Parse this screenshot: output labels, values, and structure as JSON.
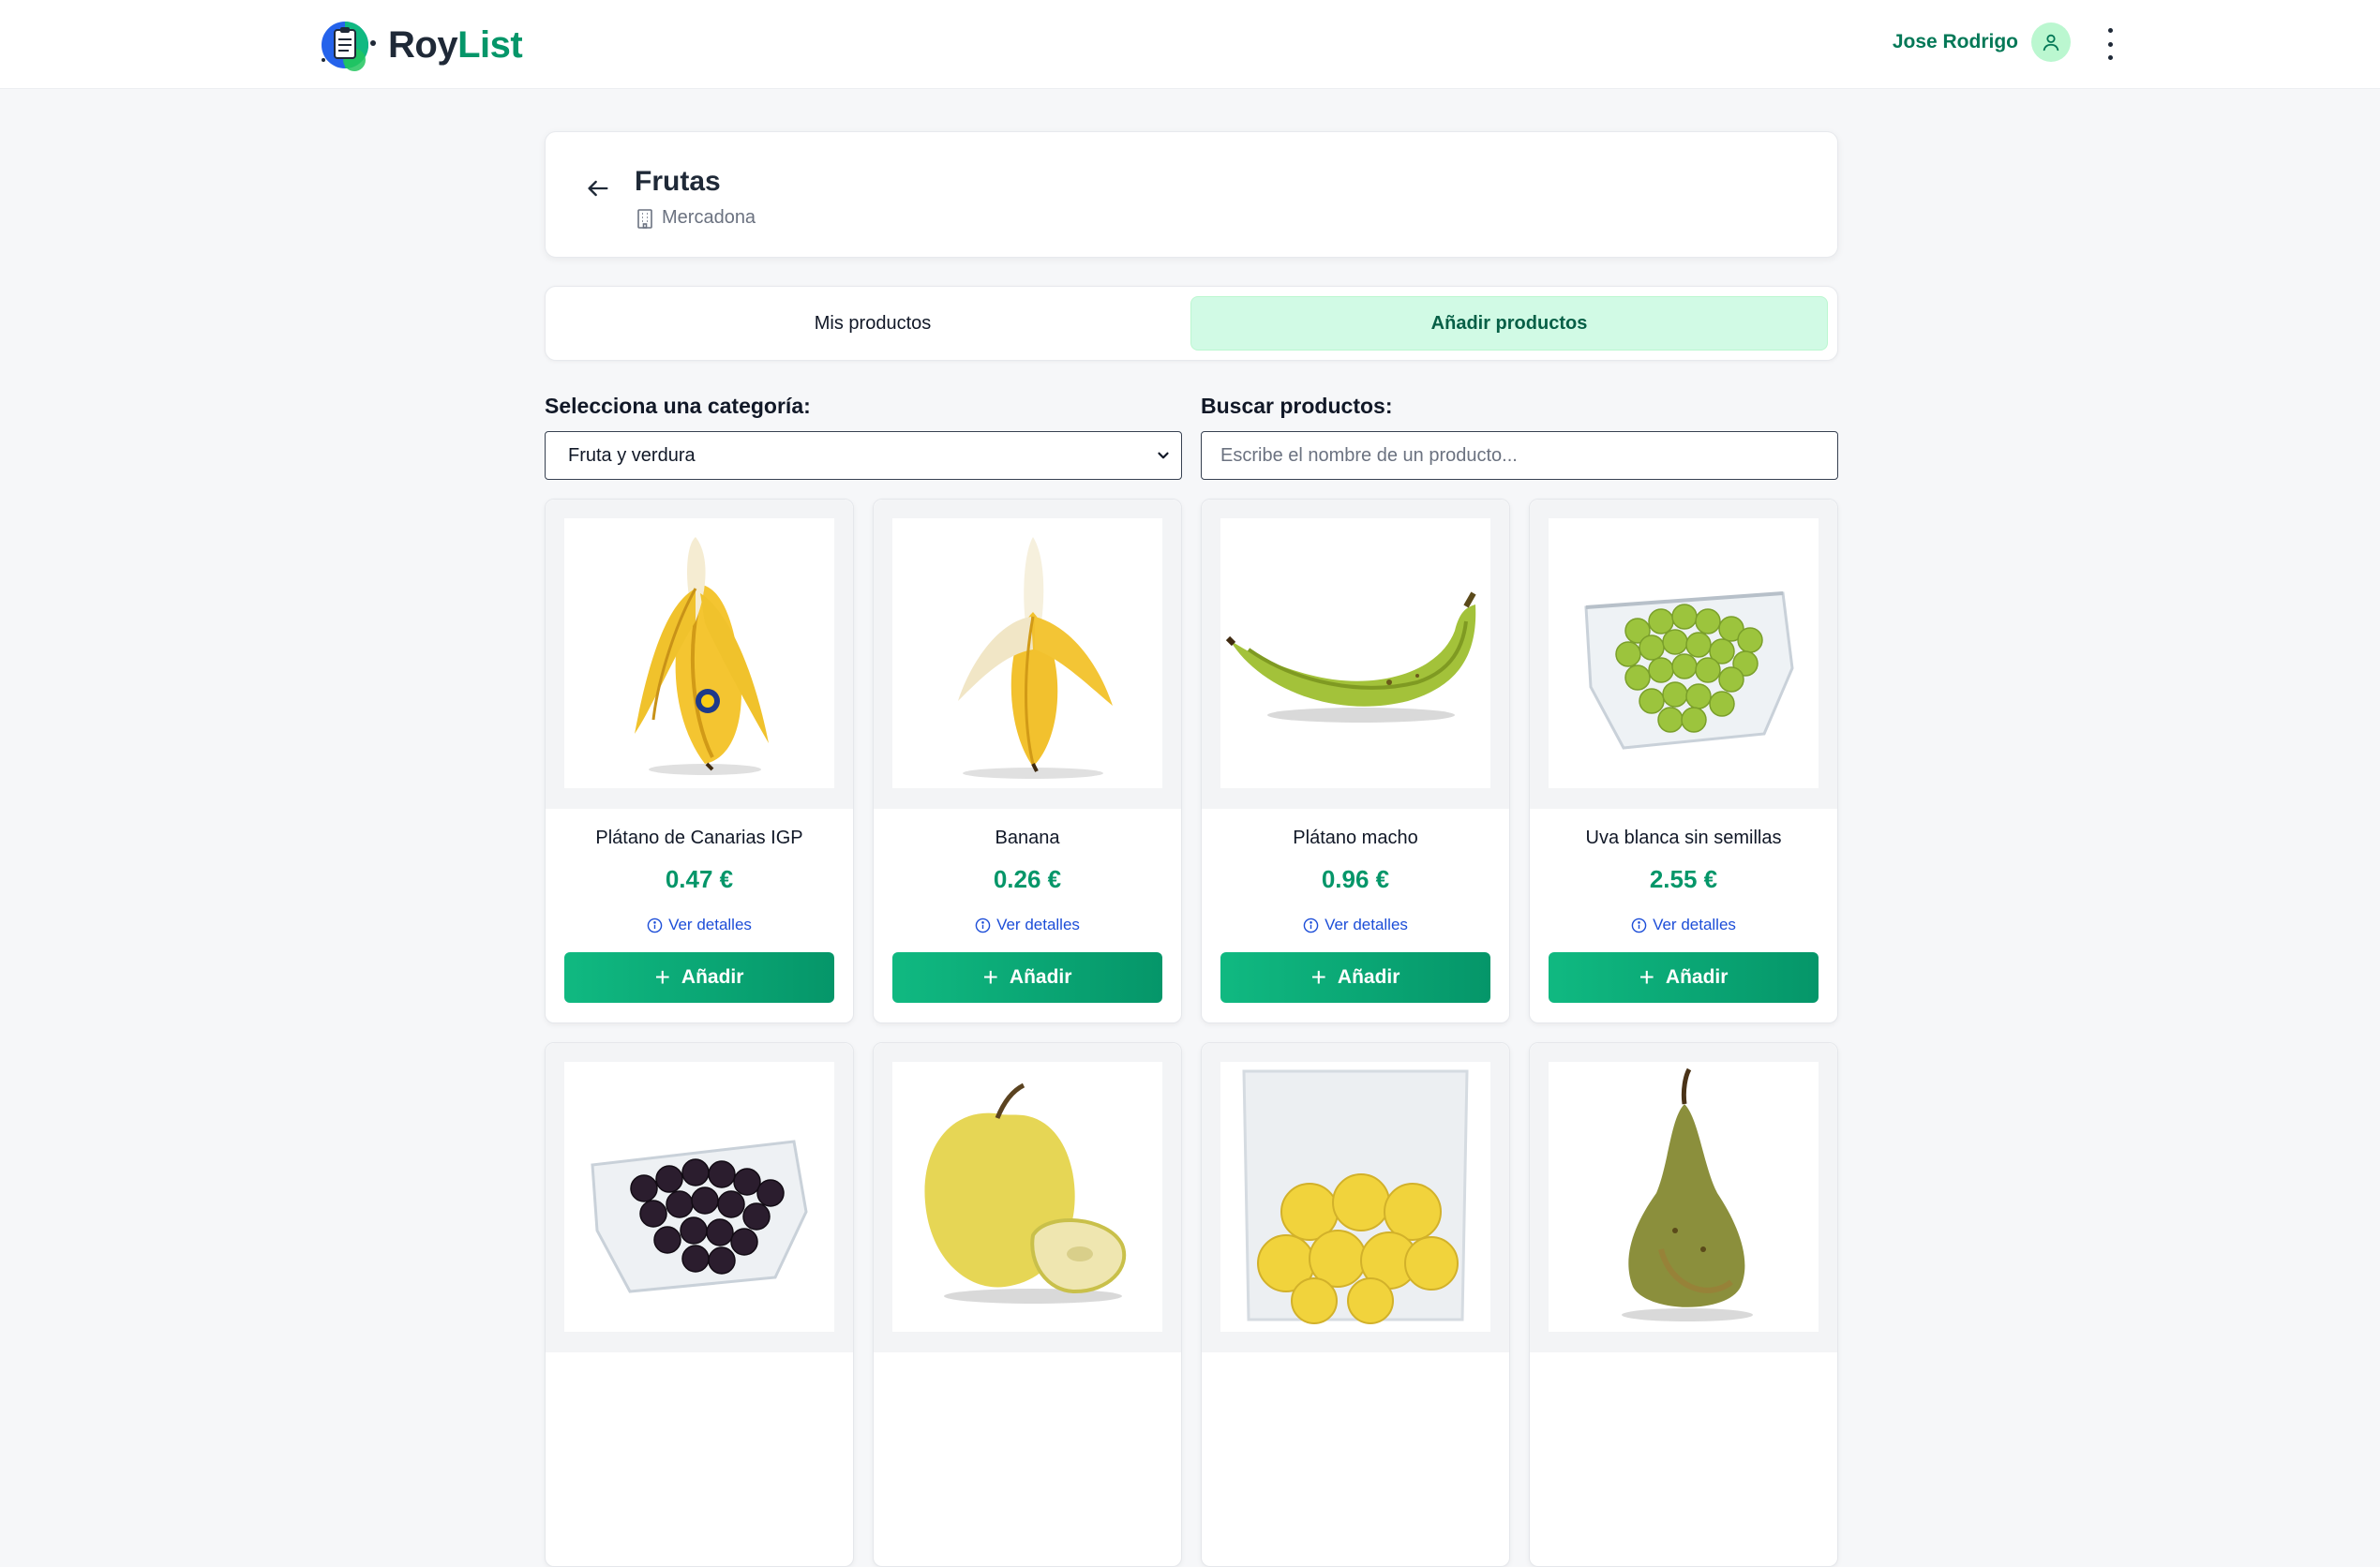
{
  "header": {
    "brand_part1": "Roy",
    "brand_part2": "List",
    "user_name": "Jose Rodrigo",
    "user_icon": "user-icon",
    "menu_icon": "kebab-menu-icon"
  },
  "title_card": {
    "title": "Frutas",
    "store": "Mercadona",
    "back_icon": "arrow-left-icon",
    "store_icon": "building-icon"
  },
  "tabs": [
    {
      "label": "Mis productos",
      "active": false
    },
    {
      "label": "Añadir productos",
      "active": true
    }
  ],
  "filters": {
    "category_label": "Selecciona una categoría:",
    "category_value": "Fruta y verdura",
    "search_label": "Buscar productos:",
    "search_placeholder": "Escribe el nombre de un producto...",
    "search_value": ""
  },
  "products": [
    {
      "name": "Plátano de Canarias IGP",
      "price": "0.47 €",
      "details": "Ver detalles",
      "add": "Añadir",
      "image": "peeled-banana-sticker"
    },
    {
      "name": "Banana",
      "price": "0.26 €",
      "details": "Ver detalles",
      "add": "Añadir",
      "image": "peeled-banana"
    },
    {
      "name": "Plátano macho",
      "price": "0.96 €",
      "details": "Ver detalles",
      "add": "Añadir",
      "image": "green-plantain"
    },
    {
      "name": "Uva blanca sin semillas",
      "price": "2.55 €",
      "details": "Ver detalles",
      "add": "Añadir",
      "image": "white-grapes-tray"
    },
    {
      "image": "black-grapes-tray"
    },
    {
      "image": "yellow-apple"
    },
    {
      "image": "apples-bag"
    },
    {
      "image": "pear"
    }
  ],
  "colors": {
    "accent": "#059669",
    "accent_light": "#d1fae5",
    "link": "#1d4ed8"
  }
}
